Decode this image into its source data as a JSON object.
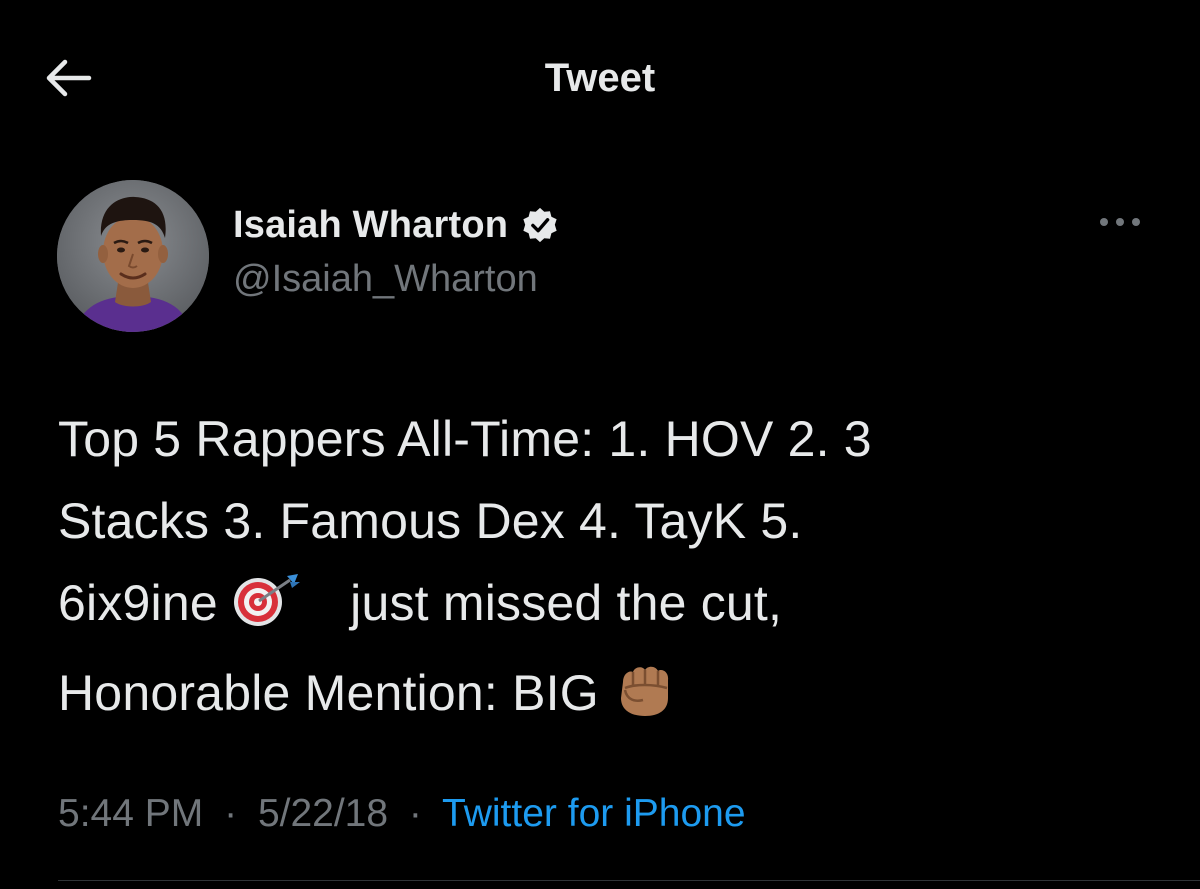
{
  "header": {
    "title": "Tweet",
    "back_icon": "arrow-left-icon"
  },
  "author": {
    "name": "Isaiah Wharton",
    "handle": "@Isaiah_Wharton",
    "verified": true,
    "verified_icon": "verified-badge-icon"
  },
  "more_icon": "more-options-icon",
  "tweet": {
    "line1": "Top 5 Rappers All-Time: 1. HOV 2. 3",
    "line2": "Stacks 3. Famous Dex 4. TayK 5.",
    "line3_before": "6ix9ine",
    "line3_emoji": "direct-hit-icon",
    "line3_after": "just missed the cut,",
    "line4_before": "Honorable Mention: BIG",
    "line4_emoji": "raised-fist-icon"
  },
  "meta": {
    "time": "5:44 PM",
    "separator": "·",
    "date": "5/22/18",
    "source": "Twitter for iPhone"
  },
  "colors": {
    "background": "#000000",
    "text": "#e7e9ea",
    "secondary": "#71767b",
    "link": "#1d9bf0"
  }
}
